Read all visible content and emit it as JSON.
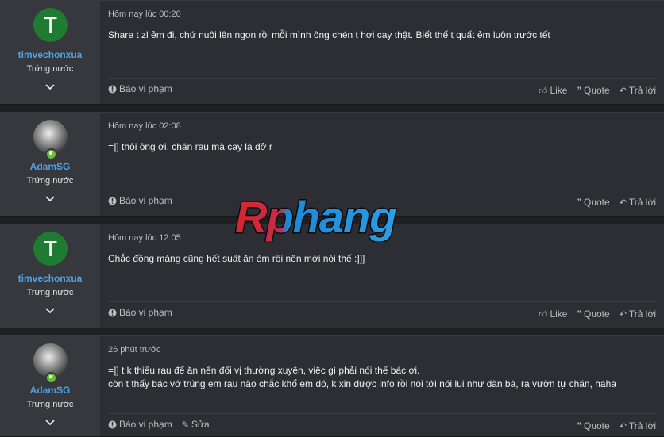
{
  "posts": [
    {
      "avatar_type": "letter",
      "avatar_letter": "T",
      "username": "timvechonxua",
      "user_title": "Trứng nước",
      "time": "Hôm nay lúc 00:20",
      "lines": [
        "Share t zl ẻm đi, chứ nuôi lên ngon rồi mỗi mình ông chén t hơi cay thật. Biết thế t quất ẻm luôn trước tết"
      ],
      "report": "Báo vi phạm",
      "edit": "",
      "like": "Like",
      "quote": "Quote",
      "reply": "Trả lời"
    },
    {
      "avatar_type": "photo",
      "avatar_letter": "",
      "username": "AdamSG",
      "user_title": "Trứng nước",
      "time": "Hôm nay lúc 02:08",
      "lines": [
        "=]] thôi ông ơi, chăn rau mà cay là dở r"
      ],
      "report": "Báo vi phạm",
      "edit": "",
      "like": "",
      "quote": "Quote",
      "reply": "Trả lời"
    },
    {
      "avatar_type": "letter",
      "avatar_letter": "T",
      "username": "timvechonxua",
      "user_title": "Trứng nước",
      "time": "Hôm nay lúc 12:05",
      "lines": [
        "Chắc đồng máng cũng hết suất ăn ẻm rồi nên mới nói thế :]]]"
      ],
      "report": "Báo vi phạm",
      "edit": "",
      "like": "Like",
      "quote": "Quote",
      "reply": "Trả lời"
    },
    {
      "avatar_type": "photo",
      "avatar_letter": "",
      "username": "AdamSG",
      "user_title": "Trứng nước",
      "time": "26 phút trước",
      "lines": [
        "=]] t k thiếu rau để ăn nên đổi vị thường xuyên, việc gì phải nói thế bác ơi.",
        "còn t thấy bác vớ trúng em rau nào chắc khổ em đó, k xin được info rồi nói tới nói lui như đàn bà, ra vườn tự chăn, haha"
      ],
      "report": "Báo vi phạm",
      "edit": "Sửa",
      "like": "",
      "quote": "Quote",
      "reply": "Trả lời"
    }
  ],
  "watermark": "Rphang",
  "colors": {
    "background": "#1f2024",
    "post_bg": "#2d2e33",
    "user_panel": "#37383d",
    "username": "#4aa3e8",
    "avatar_green": "#1f7a32",
    "online": "#6bbf3a"
  }
}
